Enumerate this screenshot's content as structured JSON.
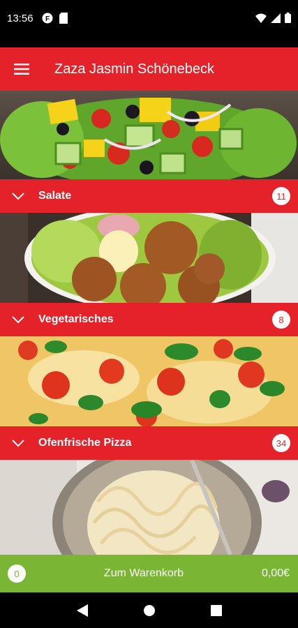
{
  "status_bar": {
    "time": "13:56"
  },
  "app_bar": {
    "title": "Zaza Jasmin Schönebeck",
    "menu_icon": "hamburger-menu-icon"
  },
  "categories": [
    {
      "label": "Salate",
      "count": "11",
      "image": "salad"
    },
    {
      "label": "Vegetarisches",
      "count": "8",
      "image": "falafel"
    },
    {
      "label": "Ofenfrische Pizza",
      "count": "34",
      "image": "pizza"
    }
  ],
  "cart": {
    "count": "0",
    "label": "Zum Warenkorb",
    "total": "0,00€"
  },
  "colors": {
    "primary": "#e5222a",
    "cart": "#7ab534"
  }
}
